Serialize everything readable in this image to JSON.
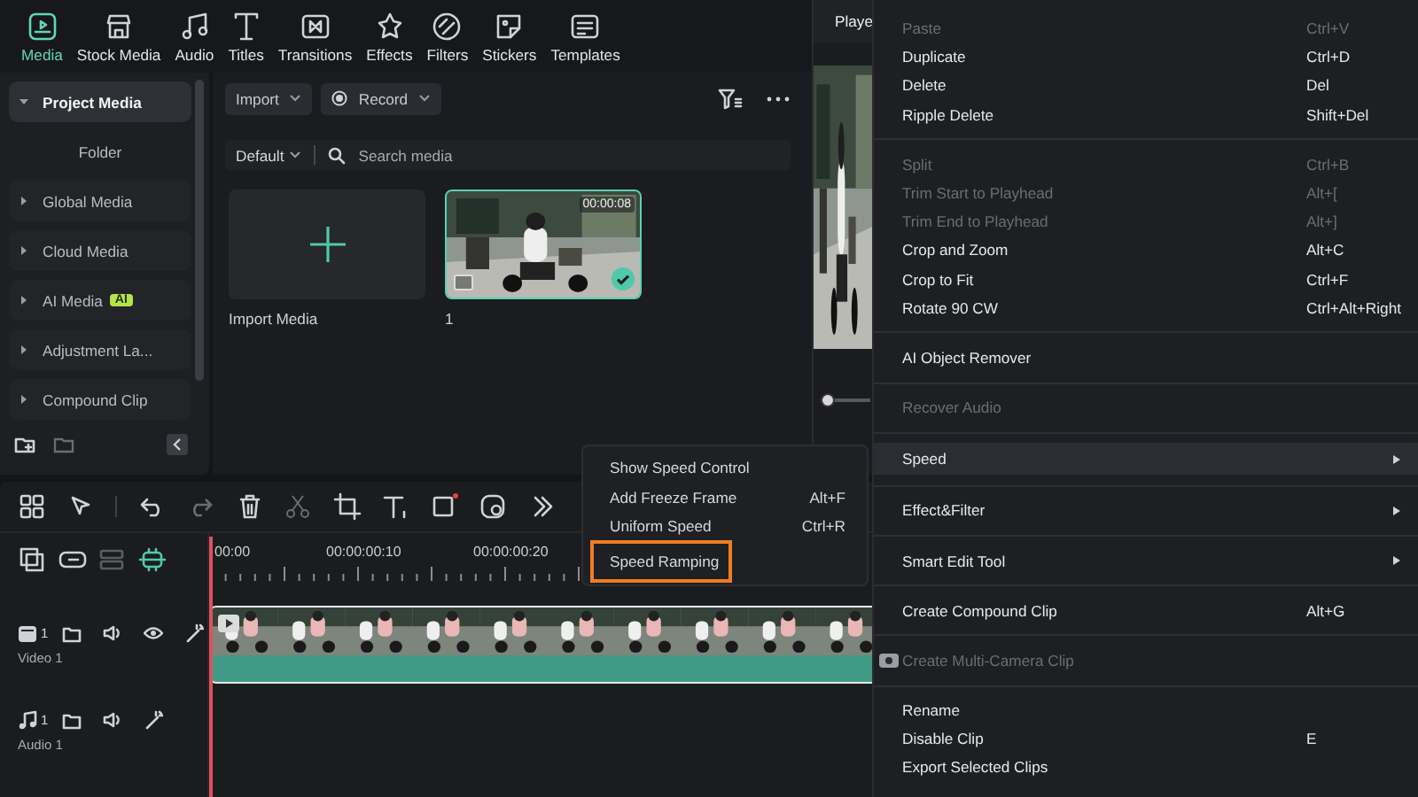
{
  "nav_tabs": [
    {
      "label": "Media",
      "selected": true
    },
    {
      "label": "Stock Media",
      "selected": false
    },
    {
      "label": "Audio",
      "selected": false
    },
    {
      "label": "Titles",
      "selected": false
    },
    {
      "label": "Transitions",
      "selected": false
    },
    {
      "label": "Effects",
      "selected": false
    },
    {
      "label": "Filters",
      "selected": false
    },
    {
      "label": "Stickers",
      "selected": false
    },
    {
      "label": "Templates",
      "selected": false
    }
  ],
  "sidebar": {
    "items": [
      {
        "label": "Project Media",
        "selected": true,
        "expanded": true,
        "children": [
          {
            "label": "Folder",
            "selected": false
          }
        ]
      },
      {
        "label": "Global Media",
        "selected": false,
        "expanded": false
      },
      {
        "label": "Cloud Media",
        "selected": false,
        "expanded": false
      },
      {
        "label": "AI Media",
        "badge": "AI",
        "selected": false,
        "expanded": false
      },
      {
        "label": "Adjustment La...",
        "selected": false,
        "expanded": false
      },
      {
        "label": "Compound Clip",
        "selected": false,
        "expanded": false
      }
    ]
  },
  "media": {
    "import": "Import",
    "record": "Record",
    "sort": "Default",
    "search": {
      "placeholder": "Search media"
    },
    "tiles": [
      {
        "kind": "import",
        "label": "Import Media",
        "selected": false
      },
      {
        "kind": "clip",
        "label": "1",
        "duration": "00:00:08",
        "selected": true
      }
    ]
  },
  "player": {
    "tab": "Playe",
    "slider": {
      "level": 0
    }
  },
  "timeline": {
    "ruler": [
      "00:00",
      "00:00:00:10",
      "00:00:00:20"
    ],
    "tracks": [
      {
        "kind": "video",
        "number": "1",
        "name": "Video 1"
      },
      {
        "kind": "audio",
        "number": "1",
        "name": "Audio 1"
      }
    ]
  },
  "context_menu": {
    "items": [
      {
        "kind": "item",
        "label": "Paste",
        "shortcut": "Ctrl+V",
        "disabled": true,
        "selected": false,
        "submenu": false
      },
      {
        "kind": "item",
        "label": "Duplicate",
        "shortcut": "Ctrl+D",
        "disabled": false,
        "selected": false,
        "submenu": false
      },
      {
        "kind": "item",
        "label": "Delete",
        "shortcut": "Del",
        "disabled": false,
        "selected": false,
        "submenu": false
      },
      {
        "kind": "item",
        "label": "Ripple Delete",
        "shortcut": "Shift+Del",
        "disabled": false,
        "selected": false,
        "submenu": false
      },
      {
        "kind": "separator"
      },
      {
        "kind": "item",
        "label": "Split",
        "shortcut": "Ctrl+B",
        "disabled": true,
        "selected": false,
        "submenu": false
      },
      {
        "kind": "item",
        "label": "Trim Start to Playhead",
        "shortcut": "Alt+[",
        "disabled": true,
        "selected": false,
        "submenu": false
      },
      {
        "kind": "item",
        "label": "Trim End to Playhead",
        "shortcut": "Alt+]",
        "disabled": true,
        "selected": false,
        "submenu": false
      },
      {
        "kind": "item",
        "label": "Crop and Zoom",
        "shortcut": "Alt+C",
        "disabled": false,
        "selected": false,
        "submenu": false
      },
      {
        "kind": "item",
        "label": "Crop to Fit",
        "shortcut": "Ctrl+F",
        "disabled": false,
        "selected": false,
        "submenu": false
      },
      {
        "kind": "item",
        "label": "Rotate 90 CW",
        "shortcut": "Ctrl+Alt+Right",
        "disabled": false,
        "selected": false,
        "submenu": false
      },
      {
        "kind": "separator"
      },
      {
        "kind": "item",
        "label": "AI Object Remover",
        "disabled": false,
        "selected": false,
        "submenu": false
      },
      {
        "kind": "separator"
      },
      {
        "kind": "item",
        "label": "Recover Audio",
        "disabled": true,
        "selected": false,
        "submenu": false
      },
      {
        "kind": "separator"
      },
      {
        "kind": "item",
        "label": "Speed",
        "disabled": false,
        "selected": true,
        "submenu": true
      },
      {
        "kind": "separator"
      },
      {
        "kind": "item",
        "label": "Effect&Filter",
        "disabled": false,
        "selected": false,
        "submenu": true
      },
      {
        "kind": "separator"
      },
      {
        "kind": "item",
        "label": "Smart Edit Tool",
        "disabled": false,
        "selected": false,
        "submenu": true
      },
      {
        "kind": "separator"
      },
      {
        "kind": "item",
        "label": "Create Compound Clip",
        "shortcut": "Alt+G",
        "disabled": false,
        "selected": false,
        "submenu": false
      },
      {
        "kind": "separator"
      },
      {
        "kind": "icon_item",
        "label": "Create Multi-Camera Clip",
        "disabled": true,
        "selected": false,
        "submenu": false
      },
      {
        "kind": "separator"
      },
      {
        "kind": "item",
        "label": "Rename",
        "disabled": false,
        "selected": false,
        "submenu": false
      },
      {
        "kind": "item",
        "label": "Disable Clip",
        "shortcut": "E",
        "disabled": false,
        "selected": false,
        "submenu": false
      },
      {
        "kind": "item",
        "label": "Export Selected Clips",
        "disabled": false,
        "selected": false,
        "submenu": false
      }
    ]
  },
  "speed_submenu": {
    "items": [
      {
        "label": "Show Speed Control",
        "selected": false
      },
      {
        "label": "Add Freeze Frame",
        "shortcut": "Alt+F",
        "selected": false
      },
      {
        "label": "Uniform Speed",
        "shortcut": "Ctrl+R",
        "selected": false
      },
      {
        "label": "Speed Ramping",
        "selected": true
      }
    ]
  }
}
